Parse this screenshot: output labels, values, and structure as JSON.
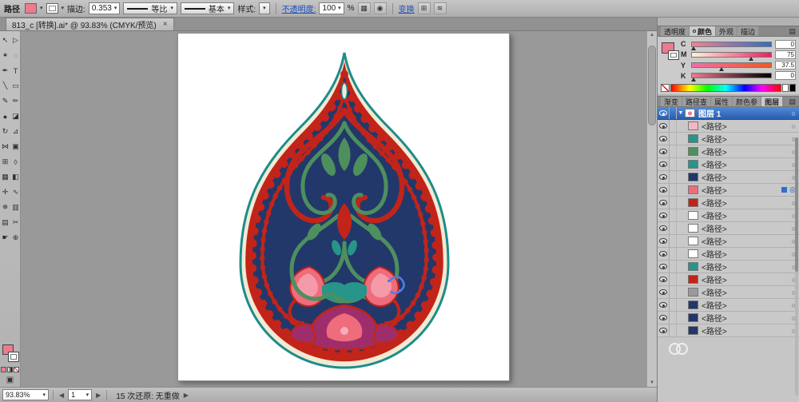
{
  "colors": {
    "uipink": "#ee7a90",
    "accent": "#2e6fd0",
    "teal": "#1c8c8c",
    "cream": "#f2ead2",
    "red": "#c2241a",
    "navy": "#22386b",
    "green": "#4e8f5e",
    "tealleaf": "#27958a",
    "coral": "#ef6c7d",
    "magenta": "#9e2e6b",
    "squiggle": "#4d7fe6"
  },
  "control_bar": {
    "context_label": "路径",
    "stroke_label": "描边:",
    "stroke_value": "0.353",
    "profile_value": "等比",
    "brush_value": "基本",
    "style_label": "样式:",
    "opacity_label": "不透明度:",
    "opacity_value": "100",
    "percent": "%",
    "transform_link": "变换"
  },
  "tab_bar": {
    "doc_title": "813_c [转换].ai* @ 93.83% (CMYK/预览)",
    "close": "×"
  },
  "toolbox": {
    "tools": [
      {
        "name": "selection",
        "glyph": "↖"
      },
      {
        "name": "direct-selection",
        "glyph": "▷"
      },
      {
        "name": "magic-wand",
        "glyph": "✶"
      },
      {
        "name": "lasso",
        "glyph": "◌"
      },
      {
        "name": "pen",
        "glyph": "✒"
      },
      {
        "name": "type",
        "glyph": "T"
      },
      {
        "name": "line-segment",
        "glyph": "╲"
      },
      {
        "name": "rectangle",
        "glyph": "▭"
      },
      {
        "name": "paintbrush",
        "glyph": "✎"
      },
      {
        "name": "pencil",
        "glyph": "✏"
      },
      {
        "name": "blob-brush",
        "glyph": "●"
      },
      {
        "name": "eraser",
        "glyph": "◪"
      },
      {
        "name": "rotate",
        "glyph": "↻"
      },
      {
        "name": "scale",
        "glyph": "⊿"
      },
      {
        "name": "width-tool",
        "glyph": "⋈"
      },
      {
        "name": "free-transform",
        "glyph": "▣"
      },
      {
        "name": "shape-builder",
        "glyph": "⊞"
      },
      {
        "name": "perspective-grid",
        "glyph": "◊"
      },
      {
        "name": "mesh",
        "glyph": "▦"
      },
      {
        "name": "gradient",
        "glyph": "◧"
      },
      {
        "name": "eyedropper",
        "glyph": "✛"
      },
      {
        "name": "blend",
        "glyph": "∿"
      },
      {
        "name": "symbol-sprayer",
        "glyph": "✵"
      },
      {
        "name": "column-graph",
        "glyph": "▥"
      },
      {
        "name": "artboard",
        "glyph": "▤"
      },
      {
        "name": "slice",
        "glyph": "✂"
      },
      {
        "name": "hand",
        "glyph": "☛"
      },
      {
        "name": "zoom",
        "glyph": "⊕"
      }
    ]
  },
  "right_dock": {
    "panel_tabs_top": [
      {
        "id": "transparency",
        "label": "透明度",
        "active": false
      },
      {
        "id": "color",
        "label": "颜色",
        "dot": true,
        "active": true
      },
      {
        "id": "appearance",
        "label": "外观",
        "active": false
      },
      {
        "id": "stroke",
        "label": "描边",
        "active": false
      }
    ],
    "color_panel": {
      "channels": [
        {
          "label": "C",
          "value": "0",
          "gradient_from": "#f08296",
          "gradient_to": "#2f6fc0",
          "pos": 2
        },
        {
          "label": "M",
          "value": "75",
          "gradient_from": "#fdf3d8",
          "gradient_to": "#ee1e5e",
          "pos": 75
        },
        {
          "label": "Y",
          "value": "37.5",
          "gradient_from": "#f06ea6",
          "gradient_to": "#ee5a26",
          "pos": 37.5
        },
        {
          "label": "K",
          "value": "0",
          "gradient_from": "#ee7a90",
          "gradient_to": "#000000",
          "pos": 2
        }
      ]
    },
    "panel_tabs_mid": [
      {
        "id": "gradient",
        "label": "渐变",
        "active": false
      },
      {
        "id": "pathfinder",
        "label": "路径查",
        "active": false
      },
      {
        "id": "properties",
        "label": "属性",
        "active": false
      },
      {
        "id": "color-guide",
        "label": "颜色参",
        "active": false
      },
      {
        "id": "layers",
        "label": "图层",
        "active": true
      }
    ],
    "layers_panel": {
      "layer_name": "图层 1",
      "items": [
        {
          "label": "<路径>",
          "thumb": "#f2b7c4"
        },
        {
          "label": "<路径>",
          "thumb": "#27958a"
        },
        {
          "label": "<路径>",
          "thumb": "#4e8f5e"
        },
        {
          "label": "<路径>",
          "thumb": "#27958a"
        },
        {
          "label": "<路径>",
          "thumb": "#22386b"
        },
        {
          "label": "<路径>",
          "thumb": "#ef6c7d",
          "selected": true
        },
        {
          "label": "<路径>",
          "thumb": "#c2241a"
        },
        {
          "label": "<路径>",
          "thumb": "#ffffff"
        },
        {
          "label": "<路径>",
          "thumb": "#ffffff"
        },
        {
          "label": "<路径>",
          "thumb": "#ffffff"
        },
        {
          "label": "<路径>",
          "thumb": "#ffffff"
        },
        {
          "label": "<路径>",
          "thumb": "#27958a"
        },
        {
          "label": "<路径>",
          "thumb": "#c2241a"
        },
        {
          "label": "<路径>",
          "thumb": "#9a9a9a"
        },
        {
          "label": "<路径>",
          "thumb": "#22386b"
        },
        {
          "label": "<路径>",
          "thumb": "#22386b"
        },
        {
          "label": "<路径>",
          "thumb": "#22386b"
        }
      ]
    }
  },
  "status_bar": {
    "zoom_value": "93.83%",
    "artboard_value": "1",
    "status_text": "15 次还原: 无重做"
  }
}
